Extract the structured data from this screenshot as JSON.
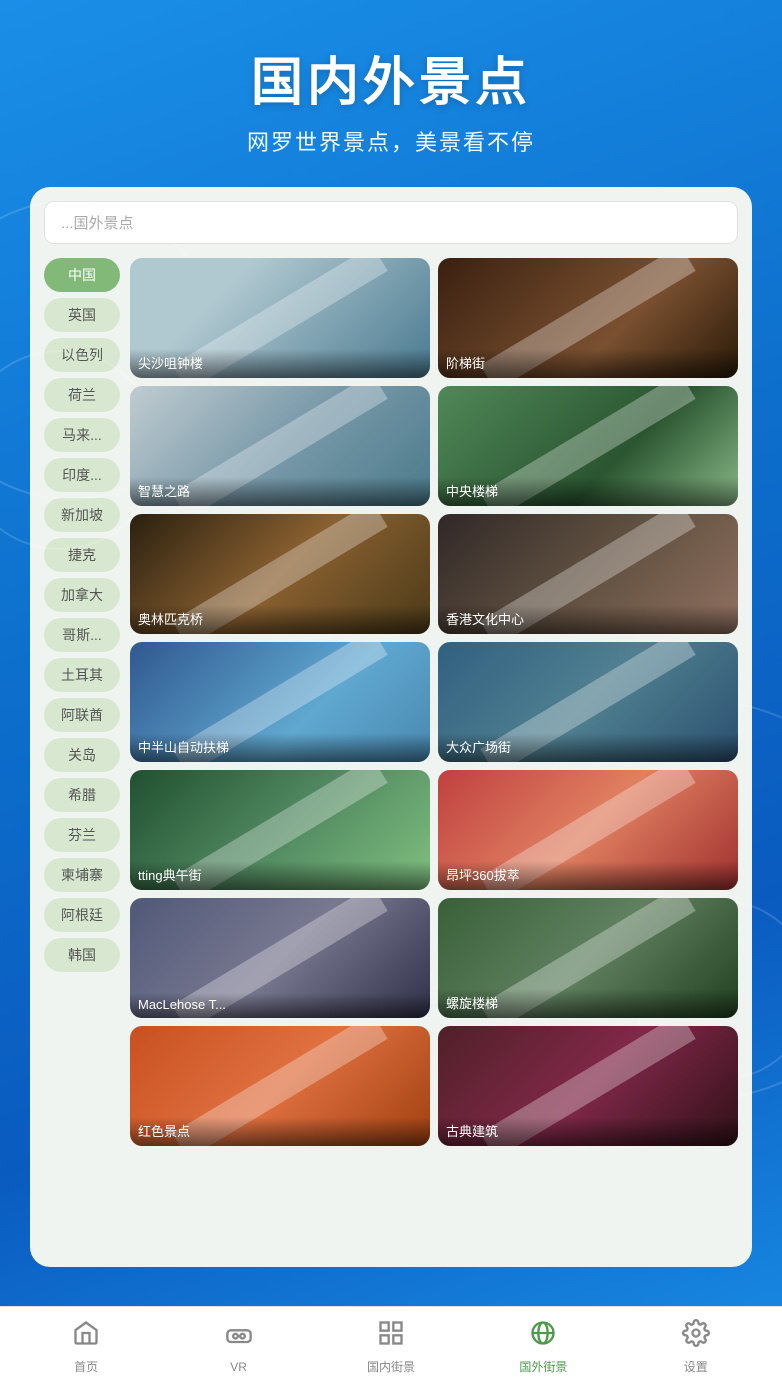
{
  "header": {
    "title": "国内外景点",
    "subtitle": "网罗世界景点，美景看不停"
  },
  "search": {
    "placeholder": "...国外景点"
  },
  "countries": [
    {
      "id": "china",
      "label": "中国",
      "active": true
    },
    {
      "id": "uk",
      "label": "英国",
      "active": false
    },
    {
      "id": "israel",
      "label": "以色列",
      "active": false
    },
    {
      "id": "netherlands",
      "label": "荷兰",
      "active": false
    },
    {
      "id": "malaysia",
      "label": "马来...",
      "active": false
    },
    {
      "id": "india",
      "label": "印度...",
      "active": false
    },
    {
      "id": "singapore",
      "label": "新加坡",
      "active": false
    },
    {
      "id": "czech",
      "label": "捷克",
      "active": false
    },
    {
      "id": "canada",
      "label": "加拿大",
      "active": false
    },
    {
      "id": "costarica",
      "label": "哥斯...",
      "active": false
    },
    {
      "id": "turkey",
      "label": "土耳其",
      "active": false
    },
    {
      "id": "uae",
      "label": "阿联酋",
      "active": false
    },
    {
      "id": "guam",
      "label": "关岛",
      "active": false
    },
    {
      "id": "greece",
      "label": "希腊",
      "active": false
    },
    {
      "id": "finland",
      "label": "芬兰",
      "active": false
    },
    {
      "id": "cambodia",
      "label": "柬埔寨",
      "active": false
    },
    {
      "id": "argentina",
      "label": "阿根廷",
      "active": false
    },
    {
      "id": "korea",
      "label": "韩国",
      "active": false
    }
  ],
  "spots": [
    {
      "id": 1,
      "label": "尖沙咀钟楼",
      "css_class": "spot-1"
    },
    {
      "id": 2,
      "label": "阶梯街",
      "css_class": "spot-2"
    },
    {
      "id": 3,
      "label": "智慧之路",
      "css_class": "spot-3"
    },
    {
      "id": 4,
      "label": "中央楼梯",
      "css_class": "spot-4"
    },
    {
      "id": 5,
      "label": "奥林匹克桥",
      "css_class": "spot-5"
    },
    {
      "id": 6,
      "label": "香港文化中心",
      "css_class": "spot-6"
    },
    {
      "id": 7,
      "label": "中半山自动扶梯",
      "css_class": "spot-7"
    },
    {
      "id": 8,
      "label": "大众广场街",
      "css_class": "spot-8"
    },
    {
      "id": 9,
      "label": "tting典午街",
      "css_class": "spot-9"
    },
    {
      "id": 10,
      "label": "昂坪360拔萃",
      "css_class": "spot-10"
    },
    {
      "id": 11,
      "label": "MacLehose T...",
      "css_class": "spot-11"
    },
    {
      "id": 12,
      "label": "螺旋楼梯",
      "css_class": "spot-12"
    },
    {
      "id": 13,
      "label": "红色景点",
      "css_class": "spot-13"
    },
    {
      "id": 14,
      "label": "古典建筑",
      "css_class": "spot-14"
    }
  ],
  "nav": {
    "items": [
      {
        "id": "home",
        "label": "首页",
        "active": false,
        "icon": "home"
      },
      {
        "id": "vr",
        "label": "VR",
        "active": false,
        "icon": "vr"
      },
      {
        "id": "domestic",
        "label": "国内街景",
        "active": false,
        "icon": "grid"
      },
      {
        "id": "foreign",
        "label": "国外街景",
        "active": true,
        "icon": "globe"
      },
      {
        "id": "settings",
        "label": "设置",
        "active": false,
        "icon": "gear"
      }
    ]
  }
}
